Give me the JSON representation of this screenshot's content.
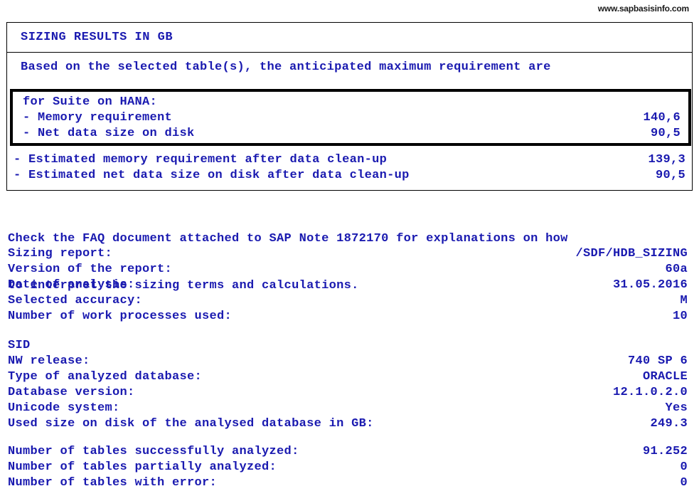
{
  "watermark": "www.sapbasisinfo.com",
  "results": {
    "title": "SIZING RESULTS IN GB",
    "intro": "Based on the selected table(s), the anticipated maximum requirement are",
    "hana": {
      "heading": "for Suite on HANA:",
      "rows": [
        {
          "label": "- Memory requirement",
          "value": "140,6"
        },
        {
          "label": "- Net data size on disk",
          "value": "90,5"
        }
      ]
    },
    "cleanup_rows": [
      {
        "label": "- Estimated memory requirement after data clean-up",
        "value": "139,3"
      },
      {
        "label": "- Estimated net data size on disk after data clean-up",
        "value": "90,5"
      }
    ]
  },
  "faq": {
    "line1": "Check the FAQ document attached to SAP Note 1872170 for explanations on how",
    "line2": "to interpret the sizing terms and calculations."
  },
  "report": {
    "rows": [
      {
        "label": "Sizing report:",
        "value": "/SDF/HDB_SIZING"
      },
      {
        "label": "Version of the report:",
        "value": "60a"
      },
      {
        "label": "Date of analysis:",
        "value": "31.05.2016"
      },
      {
        "label": "Selected accuracy:",
        "value": "M"
      },
      {
        "label": "Number of work processes used:",
        "value": "10"
      }
    ]
  },
  "system": {
    "heading": "SID",
    "rows": [
      {
        "label": "NW release:",
        "value": "740 SP 6"
      },
      {
        "label": "Type of analyzed database:",
        "value": "ORACLE"
      },
      {
        "label": "Database version:",
        "value": "12.1.0.2.0"
      },
      {
        "label": "Unicode system:",
        "value": "Yes"
      },
      {
        "label": "Used size on disk of the analysed database in GB:",
        "value": "249.3"
      }
    ]
  },
  "tables": {
    "rows": [
      {
        "label": "Number of tables successfully analyzed:",
        "value": "91.252"
      },
      {
        "label": "Number of tables partially analyzed:",
        "value": "0"
      },
      {
        "label": "Number of tables with error:",
        "value": "0"
      }
    ]
  },
  "colors": {
    "text": "#1a1ab0",
    "border": "#000000",
    "watermark": "#1a1a1a",
    "background": "#ffffff"
  }
}
